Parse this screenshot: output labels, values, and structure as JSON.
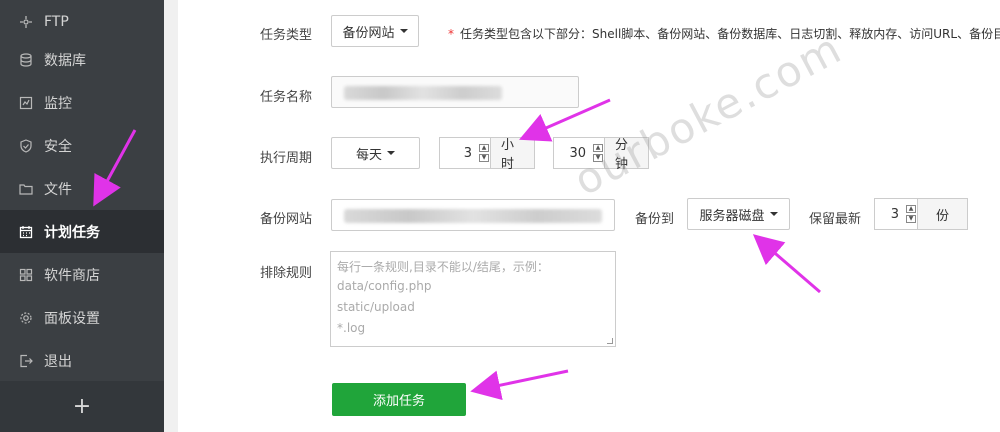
{
  "sidebar": {
    "items": [
      {
        "label": "FTP",
        "icon": "ftp-icon"
      },
      {
        "label": "数据库",
        "icon": "database-icon"
      },
      {
        "label": "监控",
        "icon": "monitor-icon"
      },
      {
        "label": "安全",
        "icon": "shield-icon"
      },
      {
        "label": "文件",
        "icon": "folder-icon"
      },
      {
        "label": "计划任务",
        "icon": "calendar-icon",
        "active": true
      },
      {
        "label": "软件商店",
        "icon": "grid-icon"
      },
      {
        "label": "面板设置",
        "icon": "gear-icon"
      },
      {
        "label": "退出",
        "icon": "logout-icon"
      }
    ],
    "add_label": "+"
  },
  "form": {
    "task_type_label": "任务类型",
    "task_type_value": "备份网站",
    "task_type_note_star": "*",
    "task_type_note": "任务类型包含以下部分：Shell脚本、备份网站、备份数据库、日志切割、释放内存、访问URL、备份目录、",
    "task_name_label": "任务名称",
    "cycle_label": "执行周期",
    "cycle_value": "每天",
    "hour_value": "3",
    "hour_unit": "小时",
    "minute_value": "30",
    "minute_unit": "分钟",
    "backup_site_label": "备份网站",
    "backup_to_label": "备份到",
    "backup_to_value": "服务器磁盘",
    "keep_latest_label": "保留最新",
    "keep_value": "3",
    "keep_unit": "份",
    "exclude_label": "排除规则",
    "exclude_placeholder_lines": [
      "每行一条规则,目录不能以/结尾，示例：",
      "data/config.php",
      "static/upload",
      " *.log"
    ],
    "submit_label": "添加任务"
  },
  "watermark": "ourboke.com",
  "colors": {
    "sidebar_bg": "#3b3f43",
    "sidebar_active_bg": "#2c2f33",
    "submit_green": "#20a53a",
    "arrow_magenta": "#e033e8"
  }
}
